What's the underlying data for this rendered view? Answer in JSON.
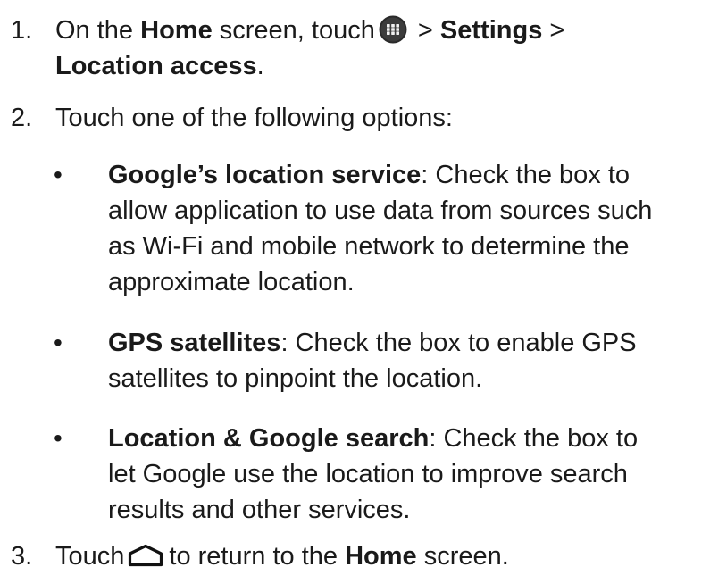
{
  "steps": {
    "s1": {
      "num": "1.",
      "t1": "On the ",
      "home": "Home",
      "t2": " screen, touch",
      "t3": " > ",
      "settings": "Settings",
      "t4": " >",
      "location_access": "Location access",
      "t5": ".",
      "icon": "apps-grid-icon"
    },
    "s2": {
      "num": "2.",
      "text": "Touch one of the following options:"
    },
    "s3": {
      "num": "3.",
      "t1": "Touch",
      "t2": "to return to the ",
      "home": "Home",
      "t3": " screen.",
      "icon": "home-outline-icon"
    }
  },
  "options": [
    {
      "bullet": "•",
      "title": "Google’s location service",
      "desc_line1": ": Check the box to",
      "desc_line2": "allow application to use data from sources such",
      "desc_line3": "as Wi-Fi and mobile network to determine the",
      "desc_line4": "approximate location."
    },
    {
      "bullet": "•",
      "title": "GPS satellites",
      "desc_line1": ": Check the box to enable GPS",
      "desc_line2": "satellites to pinpoint the location."
    },
    {
      "bullet": "•",
      "title": "Location & Google search",
      "desc_line1": ": Check the box to",
      "desc_line2": "let Google use the location to improve search",
      "desc_line3": "results and other services."
    }
  ]
}
